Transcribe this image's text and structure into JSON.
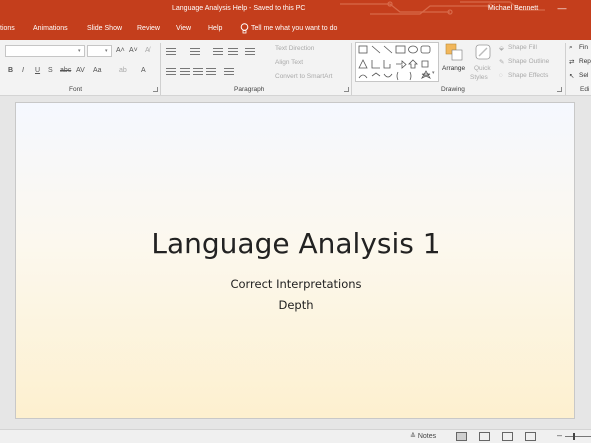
{
  "window": {
    "title": "Language Analysis Help  -  Saved to this PC",
    "user": "Michael Bennett",
    "minimize_glyph": "—"
  },
  "tabs": [
    {
      "label": "tions"
    },
    {
      "label": "Animations"
    },
    {
      "label": "Slide Show"
    },
    {
      "label": "Review"
    },
    {
      "label": "View"
    },
    {
      "label": "Help"
    }
  ],
  "tell_me": {
    "placeholder": "Tell me what you want to do",
    "icon": "lightbulb-icon"
  },
  "ribbon": {
    "font_group": {
      "label": "Font",
      "font_name": "",
      "font_size": "",
      "grow_font": "A˄",
      "shrink_font": "A˅",
      "clear_format": "A̸",
      "bold": "B",
      "italic": "I",
      "underline": "U",
      "shadow": "S",
      "strikethrough": "abc",
      "char_spacing": "AV",
      "change_case": "Aa",
      "highlight": "ab",
      "font_color": "A"
    },
    "paragraph_group": {
      "label": "Paragraph",
      "text_direction": "Text Direction",
      "align_text": "Align Text",
      "convert_smartart": "Convert to SmartArt"
    },
    "drawing_group": {
      "label": "Drawing",
      "arrange": "Arrange",
      "quick_styles_1": "Quick",
      "quick_styles_2": "Styles",
      "shape_fill": "Shape Fill",
      "shape_outline": "Shape Outline",
      "shape_effects": "Shape Effects"
    },
    "editing_group": {
      "label": "Edi",
      "find": "Fin",
      "replace": "Rep",
      "select": "Sel"
    }
  },
  "slide": {
    "title": "Language Analysis 1",
    "subtitle_line1": "Correct Interpretations",
    "subtitle_line2": "Depth"
  },
  "statusbar": {
    "notes_label": "Notes",
    "zoom_minus": "–"
  },
  "colors": {
    "accent": "#c43e1c",
    "ribbon_bg": "#f3f3f3",
    "workspace_bg": "#e6e6e6"
  }
}
